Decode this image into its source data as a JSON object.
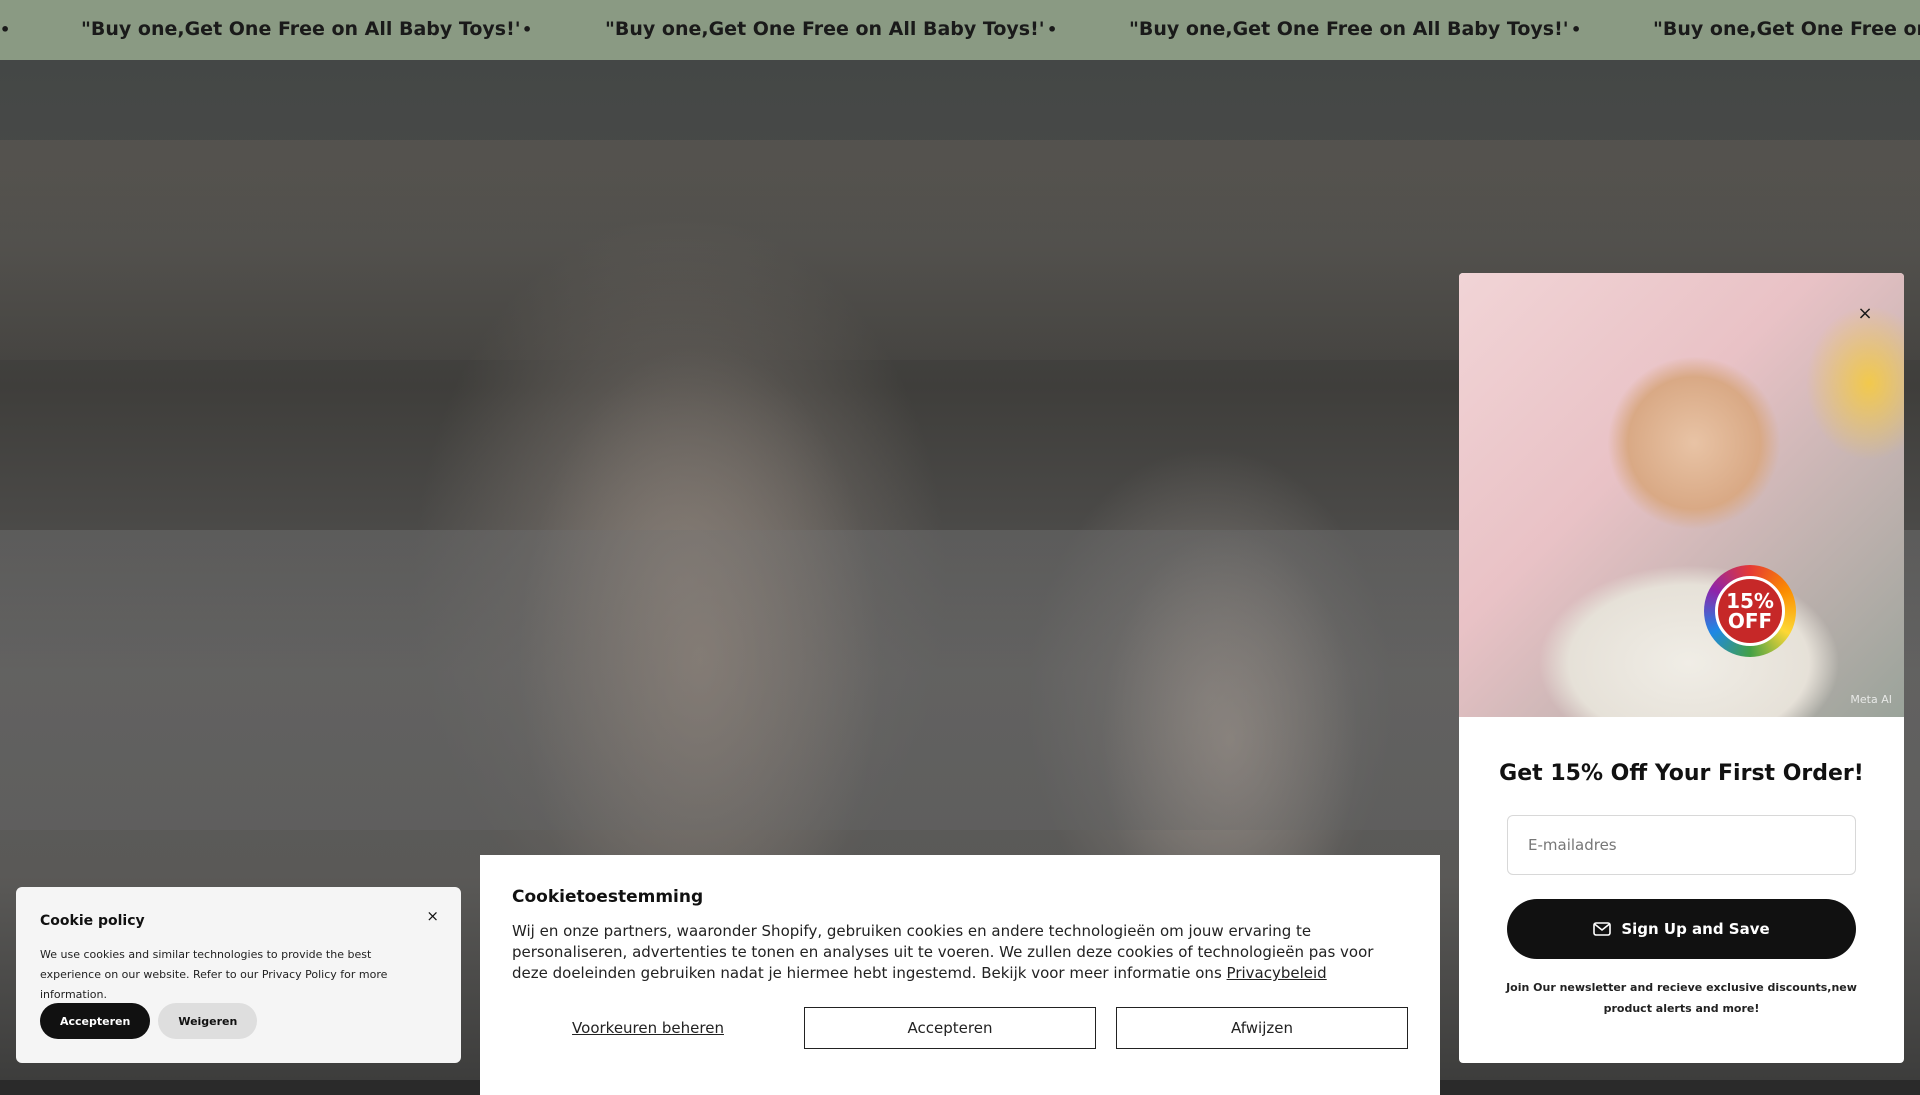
{
  "announcement": {
    "items": [
      "\"Buy one,Get One Free on All Baby Toys!'",
      "\"Buy one,Get One Free on All Baby Toys!'",
      "\"Buy one,Get One Free on All Baby Toys!'",
      "\"Buy one,Get One Free on All Baby Toys!'"
    ],
    "separator": "•"
  },
  "popup": {
    "close_label": "×",
    "badge_top": "15%",
    "badge_bottom": "OFF",
    "image_credit": "Meta AI",
    "title": "Get 15% Off Your First Order!",
    "email_placeholder": "E-mailadres",
    "submit_label": "Sign Up and Save",
    "submit_icon": "mail-icon",
    "footer": "Join Our newsletter and recieve exclusive discounts,new product alerts and more!"
  },
  "consent": {
    "title": "Cookietoestemming",
    "text": "Wij en onze partners, waaronder Shopify, gebruiken cookies en andere technologieën om jouw ervaring te personaliseren, advertenties te tonen en analyses uit te voeren. We zullen deze cookies of technologieën pas voor deze doeleinden gebruiken nadat je hiermee hebt ingestemd. Bekijk voor meer informatie ons",
    "link": "Privacybeleid",
    "manage_label": "Voorkeuren beheren",
    "accept_label": "Accepteren",
    "decline_label": "Afwijzen"
  },
  "policy": {
    "title": "Cookie policy",
    "close_label": "×",
    "text": "We use cookies and similar technologies to provide the best experience on our website. Refer to our Privacy Policy for more information.",
    "accept_label": "Accepteren",
    "decline_label": "Weigeren"
  }
}
